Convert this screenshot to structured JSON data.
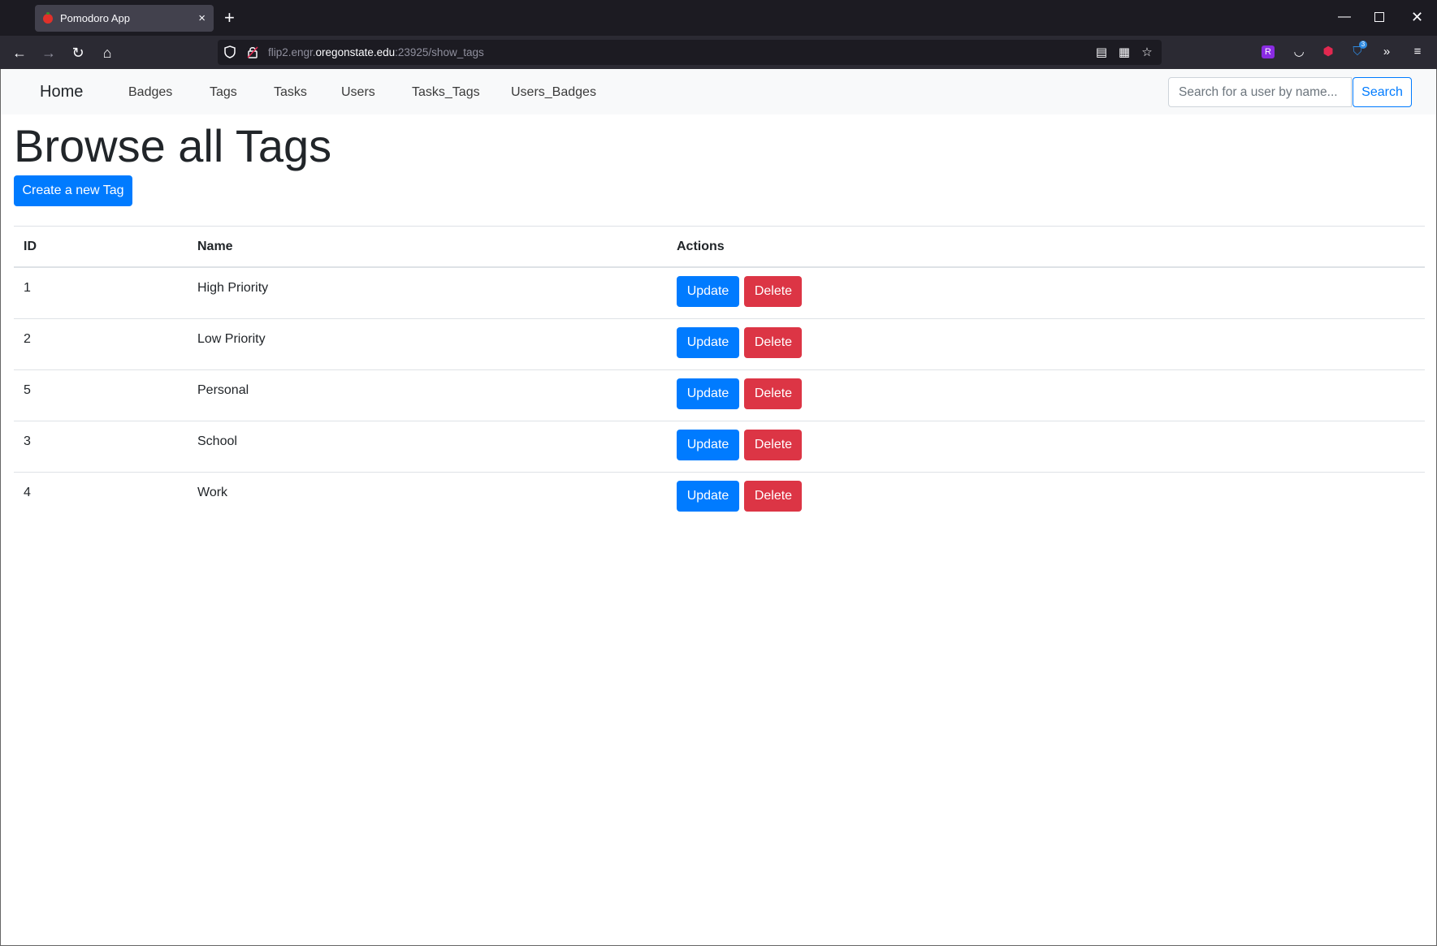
{
  "browser": {
    "tab_title": "Pomodoro App",
    "tab_close": "×",
    "new_tab": "+",
    "url": {
      "prefix": "flip2.engr.",
      "host": "oregonstate.edu",
      "suffix": ":23925/show_tags"
    },
    "extension_badge_count": "3"
  },
  "site_nav": {
    "brand": "Home",
    "links": [
      "Badges",
      "Tags",
      "Tasks",
      "Users",
      "Tasks_Tags",
      "Users_Badges"
    ],
    "search_placeholder": "Search for a user by name...",
    "search_button": "Search"
  },
  "page": {
    "title": "Browse all Tags",
    "create_button": "Create a new Tag"
  },
  "table": {
    "headers": [
      "ID",
      "Name",
      "Actions"
    ],
    "update_label": "Update",
    "delete_label": "Delete",
    "rows": [
      {
        "id": "1",
        "name": "High Priority"
      },
      {
        "id": "2",
        "name": "Low Priority"
      },
      {
        "id": "5",
        "name": "Personal"
      },
      {
        "id": "3",
        "name": "School"
      },
      {
        "id": "4",
        "name": "Work"
      }
    ]
  },
  "colors": {
    "primary": "#007bff",
    "danger": "#dc3545",
    "nav_bg": "#f8f9fa",
    "chrome_dark": "#1c1b22"
  }
}
